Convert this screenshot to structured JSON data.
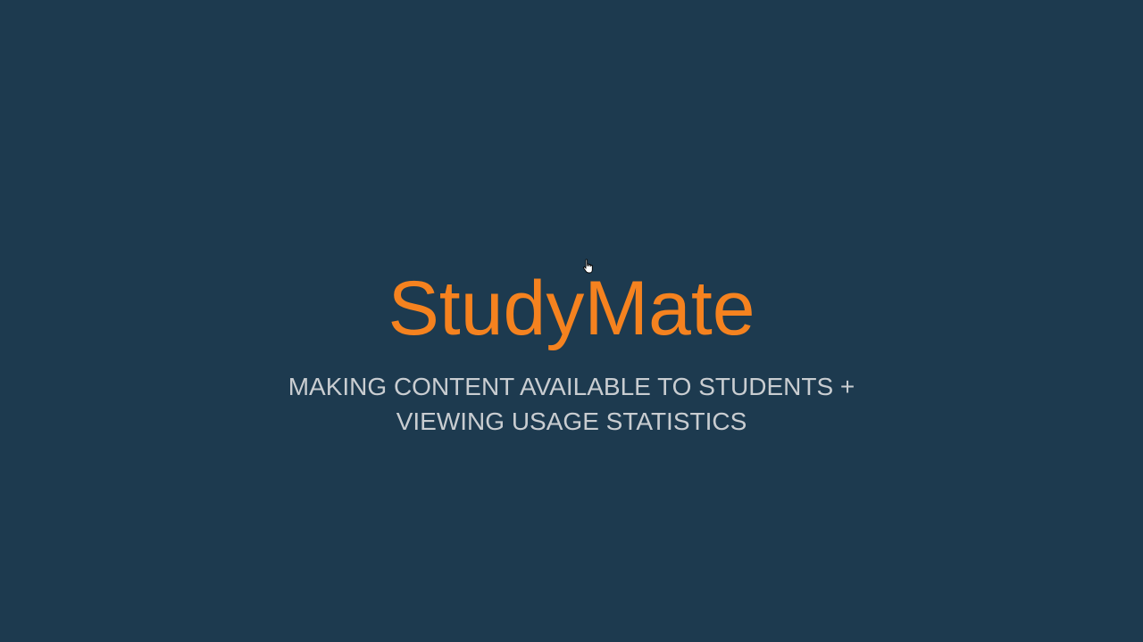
{
  "slide": {
    "title": "StudyMate",
    "subtitle_line1": "MAKING CONTENT AVAILABLE TO STUDENTS +",
    "subtitle_line2": "VIEWING USAGE STATISTICS"
  },
  "colors": {
    "background": "#1d3a4f",
    "title": "#f5821f",
    "subtitle": "#c9cdd1"
  },
  "cursor": {
    "icon": "hand-pointer-icon"
  }
}
